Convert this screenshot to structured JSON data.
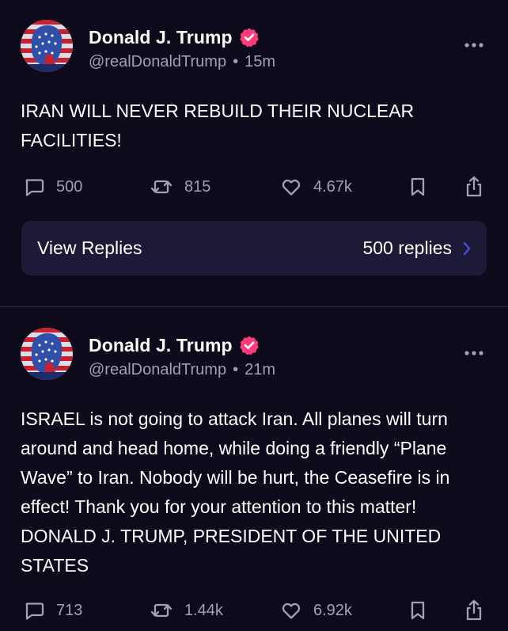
{
  "colors": {
    "background": "#0c0a1b",
    "card": "#1c1a36",
    "muted": "#a29fb6",
    "verified_badge": "#ff3b7a",
    "chevron": "#4d4be0"
  },
  "posts": [
    {
      "author": {
        "name": "Donald J. Trump",
        "handle": "@realDonaldTrump",
        "separator": "•",
        "time": "15m",
        "avatar_icon": "flag-portrait-avatar",
        "verified_icon": "verified-badge-icon"
      },
      "text": "IRAN WILL NEVER REBUILD THEIR NUCLEAR FACILITIES!",
      "actions": {
        "replies": "500",
        "reposts": "815",
        "likes": "4.67k"
      },
      "view_replies": {
        "label": "View Replies",
        "count": "500 replies"
      }
    },
    {
      "author": {
        "name": "Donald J. Trump",
        "handle": "@realDonaldTrump",
        "separator": "•",
        "time": "21m",
        "avatar_icon": "flag-portrait-avatar",
        "verified_icon": "verified-badge-icon"
      },
      "text": "ISRAEL is not going to attack Iran. All planes will turn around and head home, while doing a friendly “Plane Wave” to Iran. Nobody will be hurt, the Ceasefire is in effect! Thank you for your attention to this matter! DONALD J. TRUMP, PRESIDENT OF THE UNITED STATES",
      "actions": {
        "replies": "713",
        "reposts": "1.44k",
        "likes": "6.92k"
      }
    }
  ]
}
